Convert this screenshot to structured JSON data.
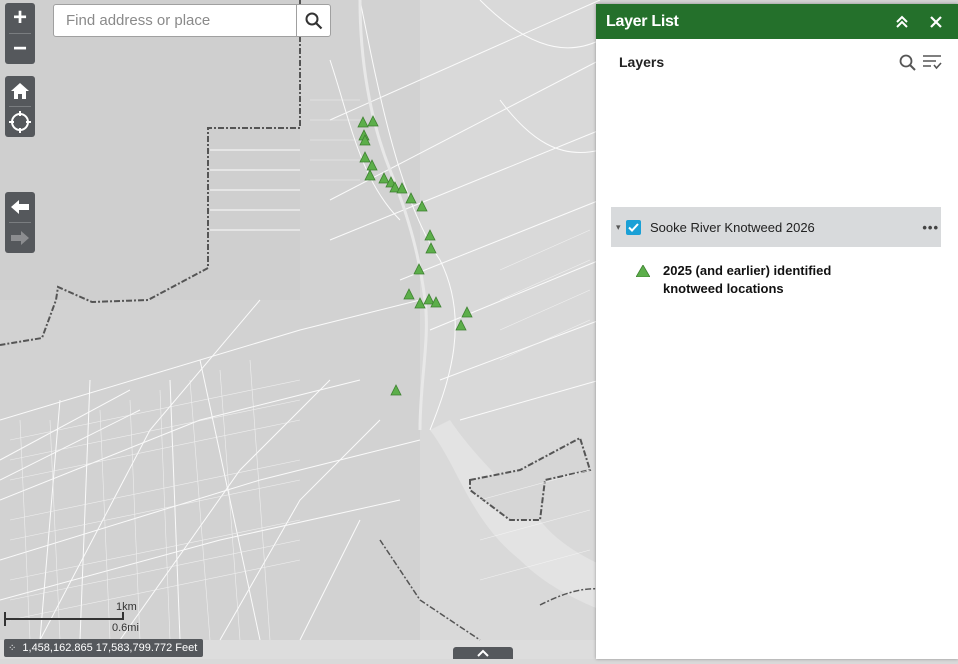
{
  "search": {
    "placeholder": "Find address or place"
  },
  "map_controls": {
    "zoom_in": "+",
    "zoom_out": "−"
  },
  "scalebar": {
    "km_label": "1km",
    "mi_label": "0.6mi"
  },
  "coordinates": {
    "text": "1,458,162.865 17,583,799.772 Feet"
  },
  "layer_panel": {
    "title": "Layer List",
    "subtitle": "Layers",
    "layers": [
      {
        "name": "Sooke River Knotweed 2026",
        "checked": true
      }
    ],
    "legend_items": [
      {
        "label": "2025 (and earlier) identified knotweed locations",
        "symbol": "green-triangle",
        "color": "#5cae4a"
      }
    ]
  },
  "colors": {
    "header_green": "#24702b",
    "map_land": "#d4d4d4",
    "map_roads": "#ffffff",
    "map_water": "#e6e6e6",
    "control_gray": "#55585c",
    "checkbox_blue": "#1aa0d6",
    "marker_green": "#5cae4a"
  }
}
